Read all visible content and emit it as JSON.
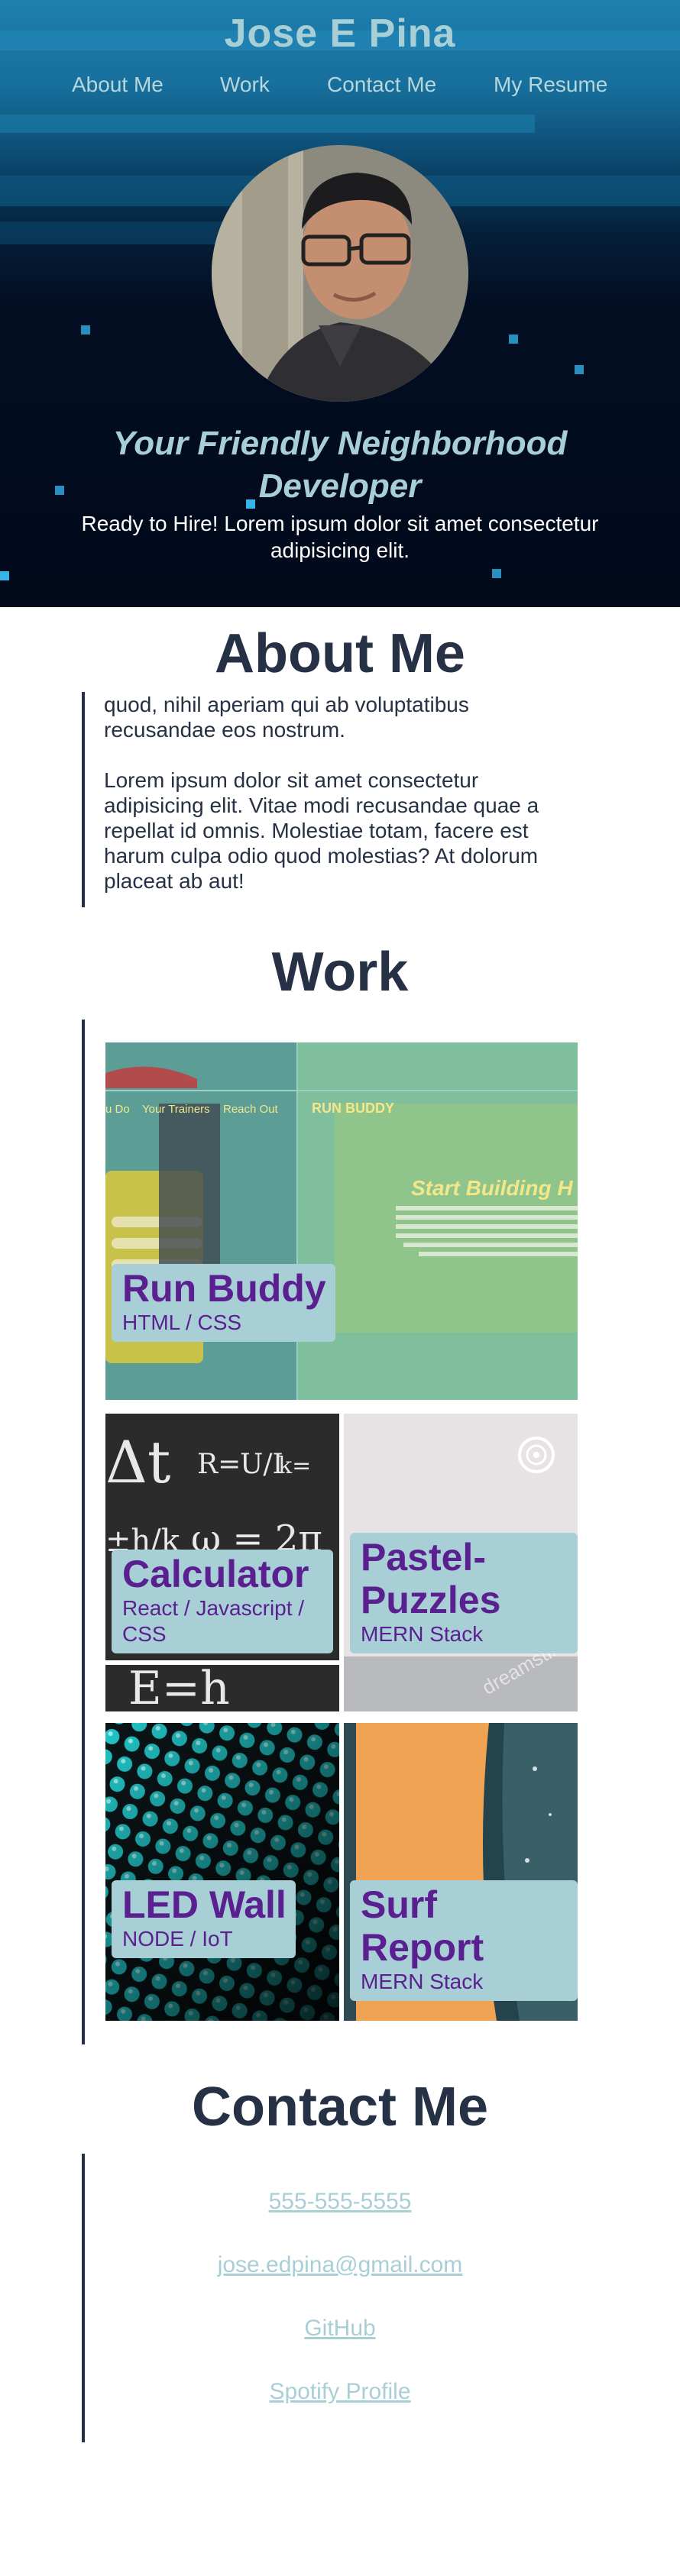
{
  "header": {
    "title": "Jose E Pina",
    "nav": [
      "About Me",
      "Work",
      "Contact Me",
      "My Resume"
    ]
  },
  "hero": {
    "tagline": "Your Friendly Neighborhood Developer",
    "intro": "Ready to Hire! Lorem ipsum dolor sit amet consectetur adipisicing elit."
  },
  "about": {
    "title": "About Me",
    "paragraphs": [
      "quod, nihil aperiam qui ab voluptatibus recusandae eos nostrum.",
      "Lorem ipsum dolor sit amet consectetur adipisicing elit. Vitae modi recusandae quae a repellat id omnis. Molestiae totam, facere est harum culpa odio quod molestias? At dolorum placeat ab aut!"
    ]
  },
  "work": {
    "title": "Work",
    "projects": [
      {
        "name": "Run Buddy",
        "tech": "HTML / CSS",
        "screenshot_text": [
          "RUN BUDDY",
          "Start Building H",
          "u Do",
          "Your Trainers",
          "Reach Out"
        ]
      },
      {
        "name": "Calculator",
        "tech": "React / Javascript / CSS"
      },
      {
        "name": "Pastel-Puzzles",
        "tech": "MERN Stack"
      },
      {
        "name": "LED Wall",
        "tech": "NODE / IoT"
      },
      {
        "name": "Surf Report",
        "tech": "MERN Stack"
      }
    ]
  },
  "contact": {
    "title": "Contact Me",
    "links": [
      "555-555-5555",
      "jose.edpina@gmail.com",
      "GitHub",
      "Spotify Profile"
    ]
  },
  "colors": {
    "heading": "#263145",
    "accent": "#a8cfd6",
    "project_name": "#5b2090"
  }
}
